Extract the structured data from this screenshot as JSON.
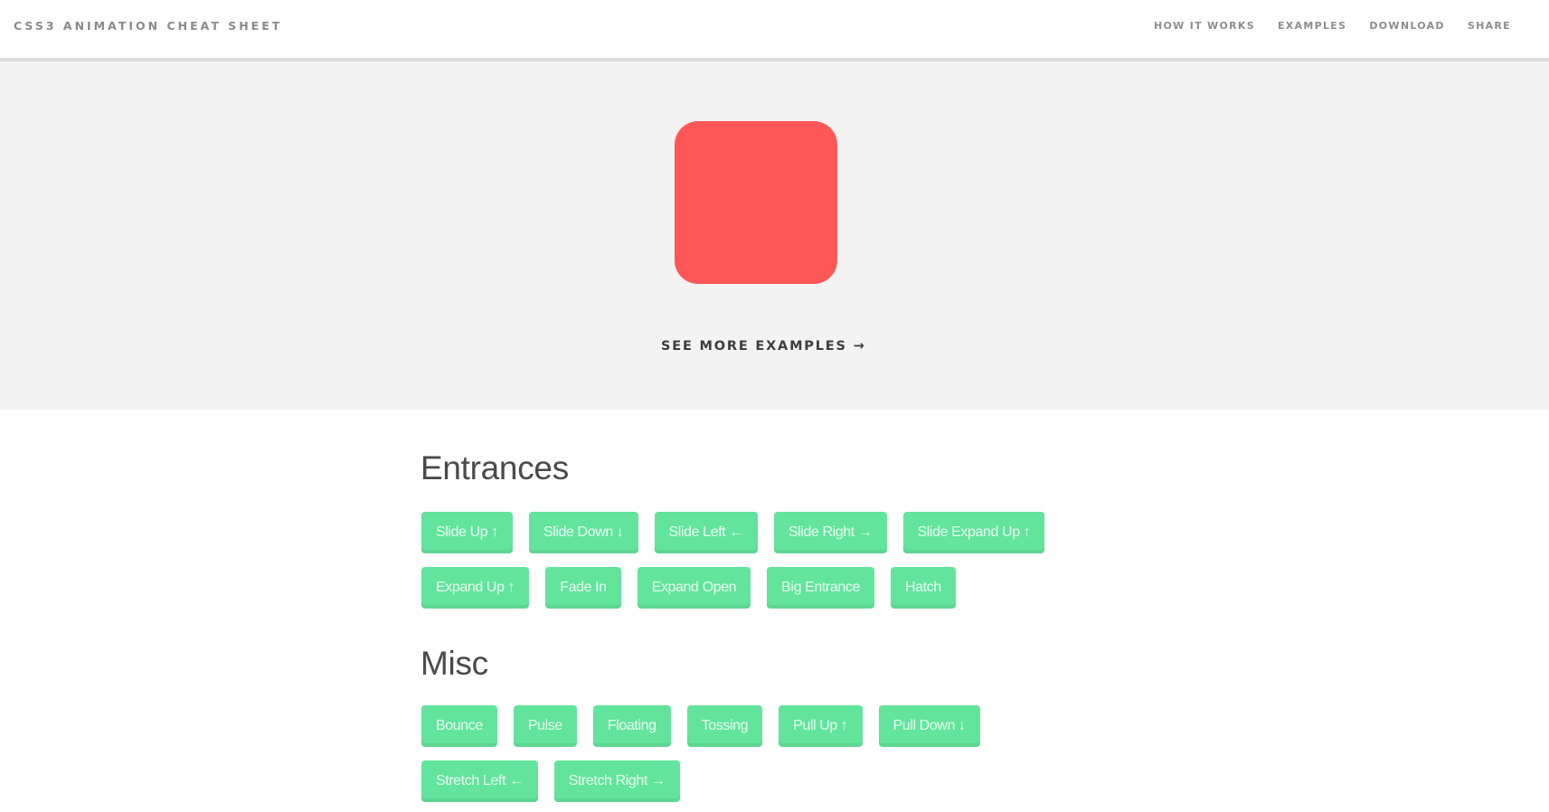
{
  "header": {
    "title": "CSS3 ANIMATION CHEAT SHEET",
    "nav": [
      "HOW IT WORKS",
      "EXAMPLES",
      "DOWNLOAD",
      "SHARE"
    ]
  },
  "hero": {
    "see_more_label": "SEE MORE EXAMPLES →"
  },
  "colors": {
    "demo_box": "#ff5757",
    "button_bg": "#62e49c",
    "hero_bg": "#f3f3f3"
  },
  "sections": [
    {
      "title": "Entrances",
      "rows": [
        [
          "Slide Up ↑",
          "Slide Down ↓",
          "Slide Left ←",
          "Slide Right →",
          "Slide Expand Up ↑"
        ],
        [
          "Expand Up ↑",
          "Fade In",
          "Expand Open",
          "Big Entrance",
          "Hatch"
        ]
      ]
    },
    {
      "title": "Misc",
      "rows": [
        [
          "Bounce",
          "Pulse",
          "Floating",
          "Tossing",
          "Pull Up ↑",
          "Pull Down ↓"
        ],
        [
          "Stretch Left ←",
          "Stretch Right →"
        ]
      ]
    }
  ]
}
